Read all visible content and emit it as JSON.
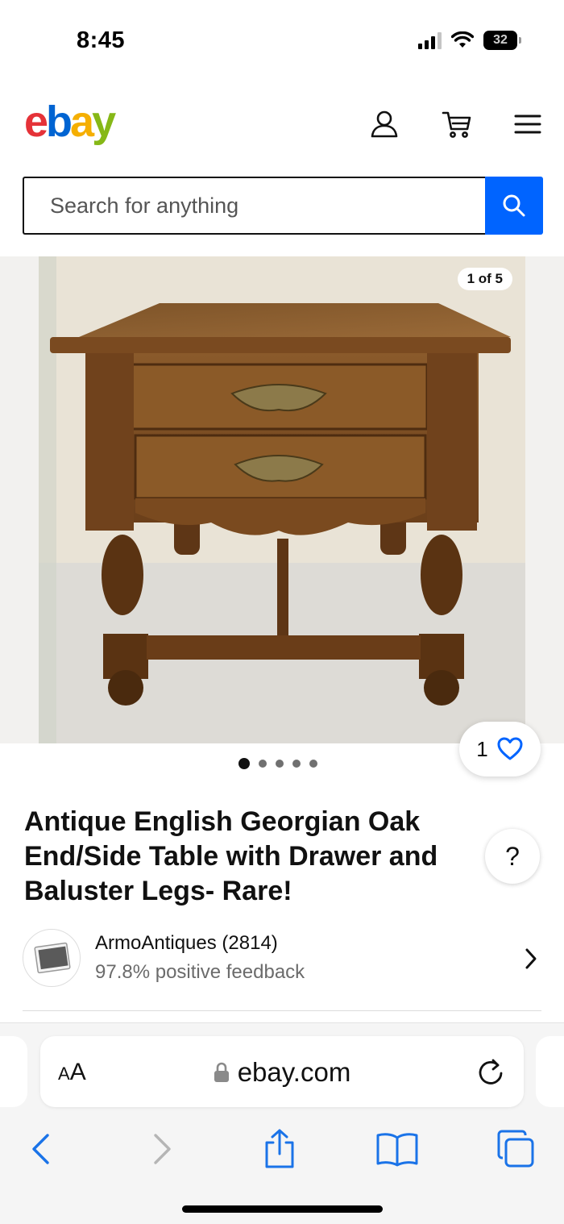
{
  "status_bar": {
    "time": "8:45",
    "battery": "32",
    "battery_level": 0.32
  },
  "header": {
    "logo": {
      "e": "e",
      "b": "b",
      "a": "a",
      "y": "y"
    },
    "icons": [
      "account-icon",
      "cart-icon",
      "menu-icon"
    ]
  },
  "search": {
    "placeholder": "Search for anything",
    "button_icon": "search-icon"
  },
  "gallery": {
    "counter": "1 of 5",
    "total_images": 5,
    "current_index": 1
  },
  "watch": {
    "count": "1",
    "icon": "heart-icon"
  },
  "listing": {
    "title": "Antique English Georgian Oak End/Side Table with Drawer and Baluster Legs- Rare!"
  },
  "help": {
    "label": "?"
  },
  "seller": {
    "name": "ArmoAntiques (2814)",
    "feedback": "97.8% positive feedback"
  },
  "browser": {
    "aa_label_big": "A",
    "aa_label_small": "A",
    "url": "ebay.com"
  },
  "colors": {
    "brand_blue": "#0064ff",
    "logo_red": "#e53238",
    "logo_blue": "#0064d2",
    "logo_yellow": "#f5af02",
    "logo_green": "#86b817",
    "safari_blue": "#1a73e8"
  }
}
